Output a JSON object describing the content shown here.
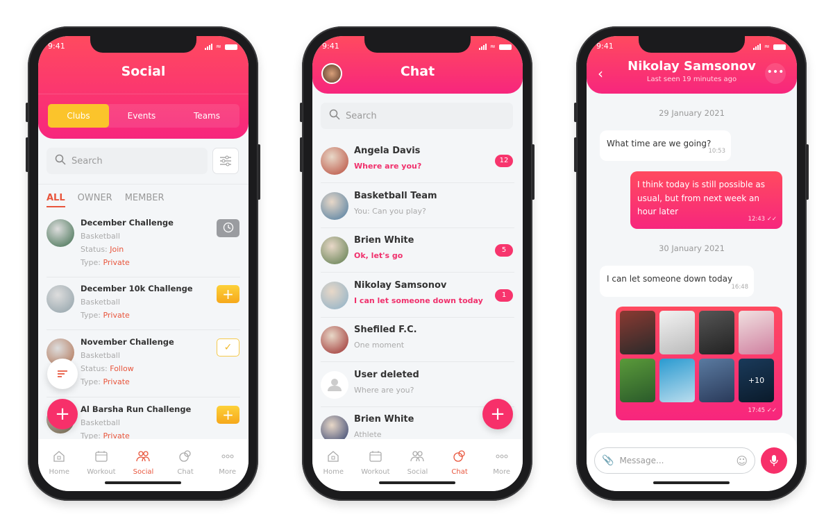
{
  "colors": {
    "accent": "#f7267d",
    "gradient_top": "#ff4a5f",
    "yellow": "#fbc42b",
    "orange_text": "#e8553c",
    "badge": "#f7356d"
  },
  "status_time": "9:41",
  "tabbar": [
    {
      "label": "Home",
      "icon": "home-icon"
    },
    {
      "label": "Workout",
      "icon": "calendar-icon"
    },
    {
      "label": "Social",
      "icon": "people-icon"
    },
    {
      "label": "Chat",
      "icon": "chat-bubbles-icon"
    },
    {
      "label": "More",
      "icon": "more-dots-icon"
    }
  ],
  "social": {
    "title": "Social",
    "segments": [
      {
        "label": "Clubs",
        "active": true
      },
      {
        "label": "Events"
      },
      {
        "label": "Teams"
      }
    ],
    "search_placeholder": "Search",
    "filters": [
      {
        "label": "ALL",
        "active": true
      },
      {
        "label": "OWNER"
      },
      {
        "label": "MEMBER"
      }
    ],
    "items": [
      {
        "title": "December Challenge",
        "sport": "Basketball",
        "status_label": "Status: ",
        "status": "Join",
        "type_label": "Type: ",
        "type": "Private",
        "action": "clock-icon"
      },
      {
        "title": "December 10k Challenge",
        "sport": "Basketball",
        "type_label": "Type: ",
        "type": "Private",
        "action": "plus-icon"
      },
      {
        "title": "November Challenge",
        "sport": "Basketball",
        "status_label": "Status: ",
        "status": "Follow",
        "type_label": "Type: ",
        "type": "Private",
        "action": "check-icon"
      },
      {
        "title": "Al Barsha Run Challenge",
        "sport": "Basketball",
        "type_label": "Type: ",
        "type": "Private",
        "action": "plus-icon"
      }
    ],
    "active_tab": "Social"
  },
  "chat": {
    "title": "Chat",
    "search_placeholder": "Search",
    "conversations": [
      {
        "name": "Angela Davis",
        "message": "Where are you?",
        "unread": "12"
      },
      {
        "name": "Basketball Team",
        "message": "You: Can you play?"
      },
      {
        "name": "Brien White",
        "message": "Ok, let's go",
        "unread": "5"
      },
      {
        "name": "Nikolay Samsonov",
        "message": "I can let someone down today",
        "unread": "1"
      },
      {
        "name": "Shefiled F.C.",
        "message": "One moment"
      },
      {
        "name": "User deleted",
        "message": "Where are you?"
      },
      {
        "name": "Brien White",
        "message": "Athlete"
      }
    ],
    "active_tab": "Chat"
  },
  "conversation": {
    "name": "Nikolay Samsonov",
    "last_seen": "Last seen 19 minutes ago",
    "dates": [
      "29 January 2021",
      "30 January 2021"
    ],
    "messages": [
      {
        "direction": "in",
        "text": "What time are we going?",
        "time": "10:53"
      },
      {
        "direction": "out",
        "text": "I think today is still possible as usual, but from next week an hour later",
        "time": "12:43"
      },
      {
        "direction": "in",
        "text": "I can let someone down today",
        "time": "16:48"
      }
    ],
    "gallery": {
      "time": "17:45",
      "more_count": "+10",
      "image_count": 8
    },
    "message_placeholder": "Message..."
  }
}
